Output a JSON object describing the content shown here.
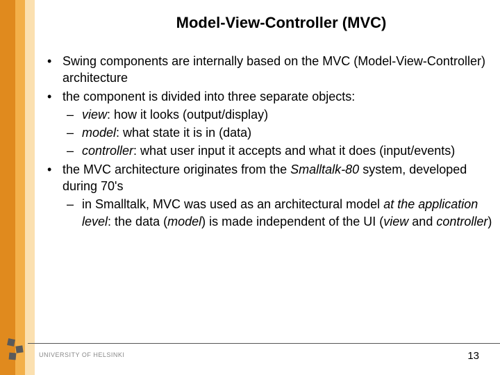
{
  "title": "Model-View-Controller (MVC)",
  "bullets": {
    "b1": "Swing components are internally based on the MVC (Model-View-Controller) architecture",
    "b2": "the component is divided into three separate objects:",
    "b2s1_i": "view",
    "b2s1_r": ": how it looks (output/display)",
    "b2s2_i": "model",
    "b2s2_r": ": what state it is in (data)",
    "b2s3_i": "controller",
    "b2s3_r": ": what user input it accepts and what it does (input/events)",
    "b3_a": "the MVC architecture originates from the ",
    "b3_i": "Smalltalk-80",
    "b3_b": " system, developed during 70's",
    "b3s1_a": "in Smalltalk, MVC was used as an architectural model ",
    "b3s1_i1": "at the application level",
    "b3s1_b": ": the data (",
    "b3s1_i2": "model",
    "b3s1_c": ") is made independent of the UI (",
    "b3s1_i3": "view",
    "b3s1_d": " and ",
    "b3s1_i4": "controller",
    "b3s1_e": ")"
  },
  "footer": {
    "university": "UNIVERSITY OF HELSINKI",
    "page": "13"
  }
}
